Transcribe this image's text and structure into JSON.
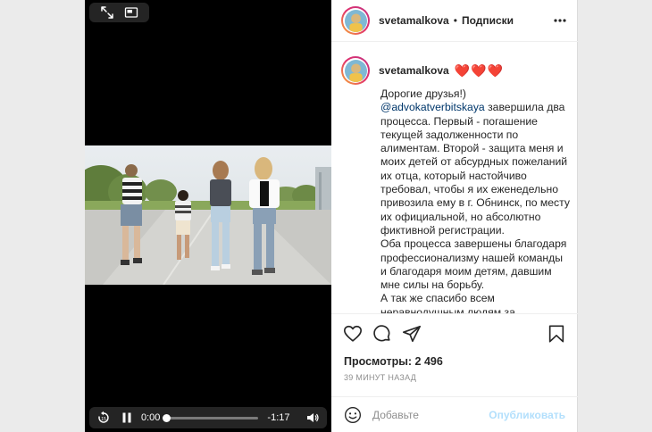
{
  "header": {
    "username": "svetamalkova",
    "dot": "•",
    "follow_label": "Подписки"
  },
  "caption": {
    "username": "svetamalkova",
    "hearts": "❤️❤️❤️",
    "greeting": "Дорогие друзья!)",
    "mention": "@advokatverbitskaya",
    "text_1": " завершила два процесса. Первый - погашение текущей задолженности по алиментам. Второй - защита меня и моих детей от абсурдных пожеланий их отца, который настойчиво требовал, чтобы я их еженедельно привозила ему в г. Обнинск, по месту их официальной, но абсолютно фиктивной регистрации.",
    "text_2": "Оба процесса завершены благодаря профессионализму нашей команды и благодаря моим детям, давшим мне силы на борьбу.",
    "text_3": "А так же спасибо всем неравнодушным людям за"
  },
  "stats": {
    "views_label": "Просмотры: 2 496",
    "time_ago": "39 МИНУТ НАЗАД"
  },
  "video": {
    "current_time": "0:00",
    "remaining_time": "-1:17",
    "progress": 0.0
  },
  "comment": {
    "placeholder": "Добавьте",
    "publish_label": "Опубликовать"
  },
  "icons": [
    "fullscreen-icon",
    "picture-in-picture-icon",
    "replay-icon",
    "pause-icon",
    "volume-icon",
    "more-options-icon",
    "heart-icon",
    "comment-icon",
    "share-icon",
    "bookmark-icon",
    "emoji-icon"
  ],
  "colors": {
    "accent_link": "#00376b",
    "publish_disabled": "#b2dffc",
    "hearts": "#e8202a"
  }
}
